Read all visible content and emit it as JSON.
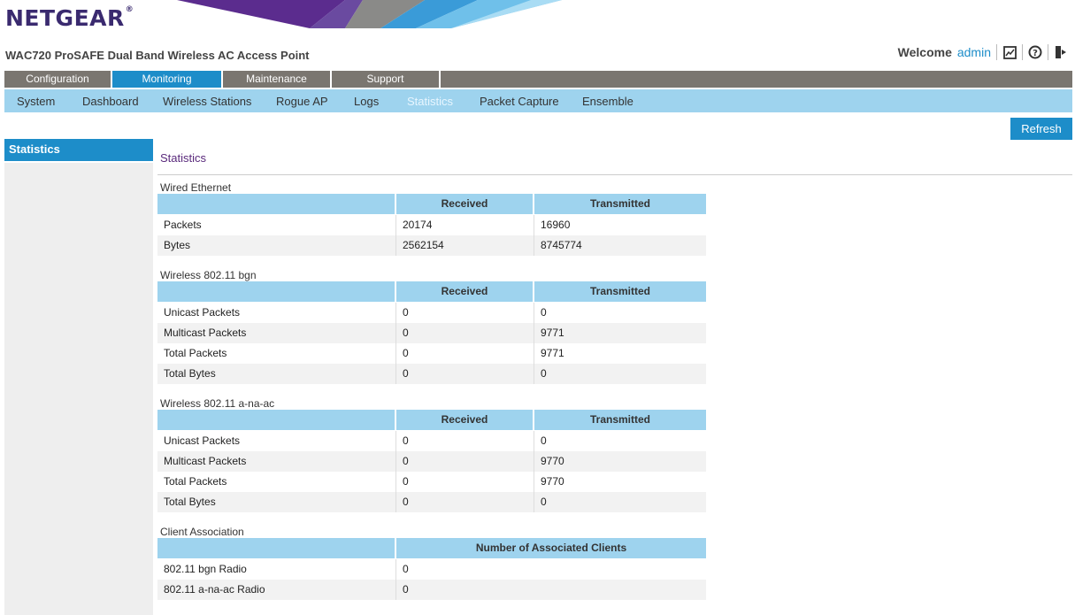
{
  "header": {
    "logo": "NETGEAR",
    "logo_reg": "®",
    "product_name": "WAC720 ProSAFE Dual Band Wireless AC Access Point",
    "welcome_label": "Welcome",
    "username": "admin"
  },
  "tabs": [
    {
      "label": "Configuration",
      "active": false
    },
    {
      "label": "Monitoring",
      "active": true
    },
    {
      "label": "Maintenance",
      "active": false
    },
    {
      "label": "Support",
      "active": false
    }
  ],
  "subnav": [
    {
      "label": "System",
      "active": false
    },
    {
      "label": "Dashboard",
      "active": false
    },
    {
      "label": "Wireless Stations",
      "active": false
    },
    {
      "label": "Rogue AP",
      "active": false
    },
    {
      "label": "Logs",
      "active": false
    },
    {
      "label": "Statistics",
      "active": true
    },
    {
      "label": "Packet Capture",
      "active": false
    },
    {
      "label": "Ensemble",
      "active": false
    }
  ],
  "refresh_label": "Refresh",
  "sidebar": {
    "selected": "Statistics"
  },
  "page_title": "Statistics",
  "sections": [
    {
      "label": "Wired Ethernet",
      "columns": [
        "",
        "Received",
        "Transmitted"
      ],
      "rows": [
        [
          "Packets",
          "20174",
          "16960"
        ],
        [
          "Bytes",
          "2562154",
          "8745774"
        ]
      ]
    },
    {
      "label": "Wireless 802.11 bgn",
      "columns": [
        "",
        "Received",
        "Transmitted"
      ],
      "rows": [
        [
          "Unicast Packets",
          "0",
          "0"
        ],
        [
          "Multicast Packets",
          "0",
          "9771"
        ],
        [
          "Total Packets",
          "0",
          "9771"
        ],
        [
          "Total Bytes",
          "0",
          "0"
        ]
      ]
    },
    {
      "label": "Wireless 802.11 a-na-ac",
      "columns": [
        "",
        "Received",
        "Transmitted"
      ],
      "rows": [
        [
          "Unicast Packets",
          "0",
          "0"
        ],
        [
          "Multicast Packets",
          "0",
          "9770"
        ],
        [
          "Total Packets",
          "0",
          "9770"
        ],
        [
          "Total Bytes",
          "0",
          "0"
        ]
      ]
    },
    {
      "label": "Client Association",
      "columns": [
        "",
        "Number of Associated Clients"
      ],
      "rows": [
        [
          "802.11 bgn Radio",
          "0"
        ],
        [
          "802.11 a-na-ac Radio",
          "0"
        ]
      ]
    }
  ],
  "icons": {
    "graph": "graph-icon",
    "help": "help-icon",
    "logout": "logout-icon"
  },
  "colors": {
    "accent": "#1d8dc9",
    "subnav": "#9ed3ee",
    "tabbar": "#7a7670",
    "brand": "#3a2a6f"
  }
}
